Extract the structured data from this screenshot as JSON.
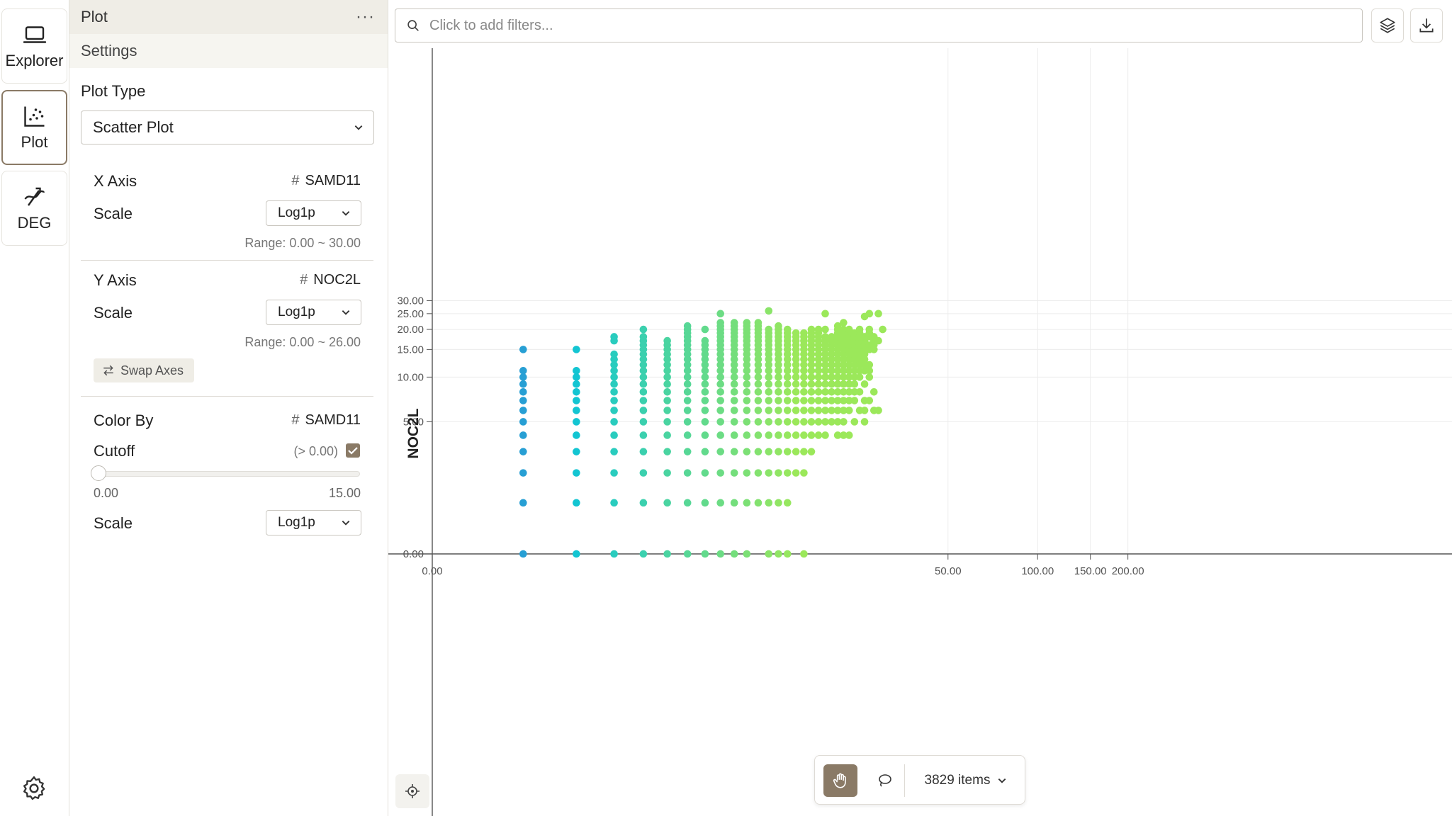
{
  "rail": {
    "items": [
      {
        "label": "Explorer",
        "icon": "laptop-icon",
        "active": false
      },
      {
        "label": "Plot",
        "icon": "scatter-plot-icon",
        "active": true
      },
      {
        "label": "DEG",
        "icon": "deg-icon",
        "active": false
      }
    ],
    "settings_icon": "gear-icon"
  },
  "panel": {
    "title": "Plot",
    "more": "···",
    "subtitle": "Settings",
    "plot_type_label": "Plot Type",
    "plot_type_value": "Scatter Plot",
    "x_axis": {
      "label": "X Axis",
      "gene": "SAMD11",
      "scale_label": "Scale",
      "scale_value": "Log1p",
      "range": "Range: 0.00 ~ 30.00"
    },
    "y_axis": {
      "label": "Y Axis",
      "gene": "NOC2L",
      "scale_label": "Scale",
      "scale_value": "Log1p",
      "range": "Range: 0.00 ~ 26.00"
    },
    "swap_label": "Swap Axes",
    "color_by": {
      "label": "Color By",
      "gene": "SAMD11",
      "cutoff_label": "Cutoff",
      "cutoff_value": "(> 0.00)",
      "cutoff_checked": true,
      "slider_min": "0.00",
      "slider_max": "15.00",
      "slider_value": 0,
      "scale_label": "Scale",
      "scale_value": "Log1p"
    },
    "hash": "#"
  },
  "main": {
    "filter_placeholder": "Click to add filters...",
    "layers_icon": "layers-icon",
    "download_icon": "download-icon",
    "locate_icon": "crosshair-icon",
    "pan_icon": "hand-icon",
    "lasso_icon": "lasso-icon",
    "items_count": "3829 items"
  },
  "colors": {
    "accent": "#8a7a66",
    "panel_header": "#efede6"
  },
  "chart_data": {
    "type": "scatter",
    "ylabel": "NOC2L",
    "x_ticks": [
      {
        "v": 0,
        "label": "0.00"
      },
      {
        "v": 50,
        "label": "50.00"
      },
      {
        "v": 100,
        "label": "100.00"
      },
      {
        "v": 150,
        "label": "150.00"
      },
      {
        "v": 200,
        "label": "200.00"
      }
    ],
    "y_ticks": [
      {
        "v": 0,
        "label": "0.00"
      },
      {
        "v": 5,
        "label": "5.00"
      },
      {
        "v": 10,
        "label": "10.00"
      },
      {
        "v": 15,
        "label": "15.00"
      },
      {
        "v": 20,
        "label": "20.00"
      },
      {
        "v": 25,
        "label": "25.00"
      },
      {
        "v": 30,
        "label": "30.00"
      }
    ],
    "x_scale": "log1p",
    "y_scale": "log1p",
    "color_scale": {
      "from": "#4a5fd6",
      "mid": "#12c6d2",
      "to": "#9be85a",
      "domain": [
        0,
        15
      ]
    },
    "columns": [
      {
        "x": 1,
        "y": [
          0,
          1,
          2,
          3,
          4,
          5,
          6,
          7,
          8,
          9,
          10,
          11,
          15
        ]
      },
      {
        "x": 2,
        "y": [
          0,
          1,
          2,
          3,
          4,
          5,
          6,
          7,
          8,
          9,
          10,
          11,
          15
        ]
      },
      {
        "x": 3,
        "y": [
          0,
          1,
          2,
          3,
          4,
          5,
          6,
          7,
          8,
          9,
          10,
          11,
          12,
          13,
          14,
          17,
          18
        ]
      },
      {
        "x": 4,
        "y": [
          0,
          1,
          2,
          3,
          4,
          5,
          6,
          7,
          8,
          9,
          10,
          11,
          12,
          13,
          14,
          15,
          16,
          17,
          18,
          20
        ]
      },
      {
        "x": 5,
        "y": [
          0,
          1,
          2,
          3,
          4,
          5,
          6,
          7,
          8,
          9,
          10,
          11,
          12,
          13,
          14,
          15,
          16,
          17
        ]
      },
      {
        "x": 6,
        "y": [
          0,
          1,
          2,
          3,
          4,
          5,
          6,
          7,
          8,
          9,
          10,
          11,
          12,
          13,
          14,
          15,
          16,
          17,
          18,
          19,
          20,
          21
        ]
      },
      {
        "x": 7,
        "y": [
          0,
          1,
          2,
          3,
          4,
          5,
          6,
          7,
          8,
          9,
          10,
          11,
          12,
          13,
          14,
          15,
          16,
          17,
          20
        ]
      },
      {
        "x": 8,
        "y": [
          0,
          1,
          2,
          3,
          4,
          5,
          6,
          7,
          8,
          9,
          10,
          11,
          12,
          13,
          14,
          15,
          16,
          17,
          18,
          19,
          20,
          21,
          22,
          25
        ]
      },
      {
        "x": 9,
        "y": [
          0,
          1,
          2,
          3,
          4,
          5,
          6,
          7,
          8,
          9,
          10,
          11,
          12,
          13,
          14,
          15,
          16,
          17,
          18,
          19,
          20,
          21,
          22
        ]
      },
      {
        "x": 10,
        "y": [
          0,
          1,
          2,
          3,
          4,
          5,
          6,
          7,
          8,
          9,
          10,
          11,
          12,
          13,
          14,
          15,
          16,
          17,
          18,
          19,
          20,
          21,
          22
        ]
      },
      {
        "x": 11,
        "y": [
          1,
          2,
          3,
          4,
          5,
          6,
          7,
          8,
          9,
          10,
          11,
          12,
          13,
          14,
          15,
          16,
          17,
          18,
          19,
          20,
          21,
          22
        ]
      },
      {
        "x": 12,
        "y": [
          0,
          1,
          2,
          3,
          4,
          5,
          6,
          7,
          8,
          9,
          10,
          11,
          12,
          13,
          14,
          15,
          16,
          17,
          18,
          19,
          20,
          26
        ]
      },
      {
        "x": 13,
        "y": [
          0,
          1,
          2,
          3,
          4,
          5,
          6,
          7,
          8,
          9,
          10,
          11,
          12,
          13,
          14,
          15,
          16,
          17,
          18,
          19,
          20,
          21
        ]
      },
      {
        "x": 14,
        "y": [
          0,
          1,
          2,
          3,
          4,
          5,
          6,
          7,
          8,
          9,
          10,
          11,
          12,
          13,
          14,
          15,
          16,
          17,
          18,
          19,
          20
        ]
      },
      {
        "x": 15,
        "y": [
          2,
          3,
          4,
          5,
          6,
          7,
          8,
          9,
          10,
          11,
          12,
          13,
          14,
          15,
          16,
          17,
          18,
          19
        ]
      },
      {
        "x": 16,
        "y": [
          0,
          2,
          3,
          4,
          5,
          6,
          7,
          8,
          9,
          10,
          11,
          12,
          13,
          14,
          15,
          16,
          17,
          18,
          19
        ]
      },
      {
        "x": 17,
        "y": [
          3,
          4,
          5,
          6,
          7,
          8,
          9,
          10,
          11,
          12,
          13,
          14,
          15,
          16,
          17,
          18,
          19,
          20
        ]
      },
      {
        "x": 18,
        "y": [
          4,
          5,
          6,
          7,
          8,
          9,
          10,
          11,
          12,
          13,
          14,
          15,
          16,
          17,
          18,
          19,
          20
        ]
      },
      {
        "x": 19,
        "y": [
          4,
          5,
          6,
          7,
          8,
          9,
          10,
          11,
          12,
          13,
          14,
          15,
          16,
          17,
          18,
          20,
          25
        ]
      },
      {
        "x": 20,
        "y": [
          5,
          6,
          7,
          8,
          9,
          10,
          11,
          12,
          13,
          14,
          15,
          16,
          17,
          18
        ]
      },
      {
        "x": 21,
        "y": [
          4,
          5,
          6,
          7,
          8,
          9,
          10,
          11,
          12,
          13,
          14,
          15,
          16,
          17,
          18,
          19,
          20,
          21
        ]
      },
      {
        "x": 22,
        "y": [
          4,
          5,
          6,
          7,
          8,
          9,
          10,
          11,
          12,
          13,
          14,
          15,
          16,
          17,
          18,
          19,
          20,
          22
        ]
      },
      {
        "x": 23,
        "y": [
          4,
          6,
          7,
          8,
          9,
          10,
          11,
          12,
          13,
          14,
          15,
          16,
          17,
          18,
          19,
          20
        ]
      },
      {
        "x": 24,
        "y": [
          5,
          7,
          8,
          9,
          10,
          11,
          12,
          13,
          14,
          15,
          16,
          17,
          18,
          19
        ]
      },
      {
        "x": 25,
        "y": [
          6,
          8,
          10,
          11,
          12,
          13,
          14,
          15,
          16,
          17,
          18,
          19,
          20
        ]
      },
      {
        "x": 26,
        "y": [
          5,
          6,
          7,
          9,
          11,
          12,
          13,
          14,
          15,
          16,
          17,
          18,
          24
        ]
      },
      {
        "x": 27,
        "y": [
          7,
          10,
          11,
          12,
          15,
          16,
          18,
          19,
          20,
          25
        ]
      },
      {
        "x": 28,
        "y": [
          6,
          8,
          15,
          16,
          17,
          18
        ]
      },
      {
        "x": 29,
        "y": [
          6,
          17,
          25
        ]
      },
      {
        "x": 30,
        "y": [
          20
        ]
      }
    ]
  }
}
